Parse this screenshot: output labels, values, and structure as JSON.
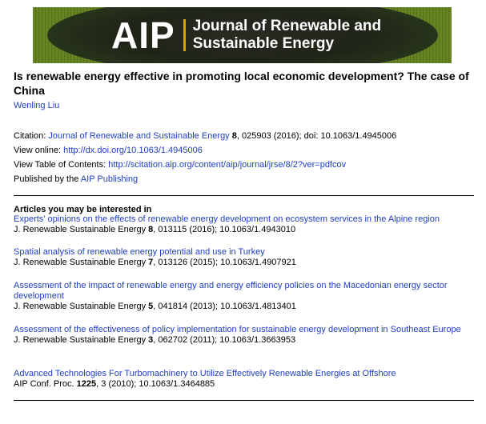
{
  "banner": {
    "logo_text": "AIP",
    "journal_line1": "Journal of Renewable and",
    "journal_line2": "Sustainable Energy"
  },
  "article": {
    "title": "Is renewable energy effective in promoting local economic development? The case of China",
    "author": "Wenling Liu"
  },
  "citation": {
    "label": "Citation: ",
    "journal": "Journal of Renewable and Sustainable Energy",
    "volume": "8",
    "rest": ", 025903 (2016); doi: 10.1063/1.4945006"
  },
  "view_online": {
    "label": "View online: ",
    "url": "http://dx.doi.org/10.1063/1.4945006"
  },
  "view_toc": {
    "label": "View Table of Contents: ",
    "url": "http://scitation.aip.org/content/aip/journal/jrse/8/2?ver=pdfcov"
  },
  "publisher": {
    "label": "Published by the ",
    "name": "AIP Publishing"
  },
  "related": {
    "heading": "Articles you may be interested in",
    "items": [
      {
        "title": "Experts' opinions on the effects of renewable energy development on ecosystem services in the Alpine region",
        "journal": "J. Renewable Sustainable Energy ",
        "volume": "8",
        "rest": ", 013115 (2016); 10.1063/1.4943010"
      },
      {
        "title": "Spatial analysis of renewable energy potential and use in Turkey",
        "journal": "J. Renewable Sustainable Energy ",
        "volume": "7",
        "rest": ", 013126 (2015); 10.1063/1.4907921"
      },
      {
        "title": "Assessment of the impact of renewable energy and energy efficiency policies on the Macedonian energy sector development",
        "journal": "J. Renewable Sustainable Energy ",
        "volume": "5",
        "rest": ", 041814 (2013); 10.1063/1.4813401"
      },
      {
        "title": "Assessment of the effectiveness of policy implementation for sustainable energy development in Southeast Europe",
        "journal": "J. Renewable Sustainable Energy ",
        "volume": "3",
        "rest": ", 062702 (2011); 10.1063/1.3663953"
      },
      {
        "title": "Advanced Technologies For Turbomachinery to Utilize Effectively Renewable Energies at Offshore",
        "journal": "AIP Conf. Proc. ",
        "volume": "1225",
        "rest": ", 3 (2010); 10.1063/1.3464885"
      }
    ]
  }
}
